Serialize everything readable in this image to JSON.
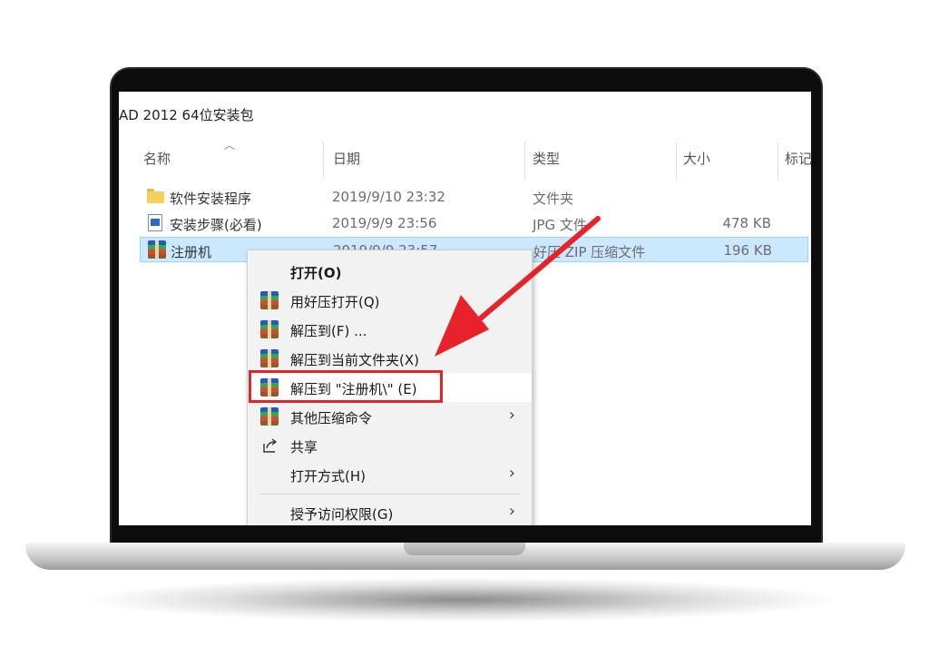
{
  "window": {
    "title": "AD 2012 64位安装包"
  },
  "columns": {
    "name": "名称",
    "date": "日期",
    "type": "类型",
    "size": "大小",
    "tags": "标记"
  },
  "files": [
    {
      "name": "软件安装程序",
      "date": "2019/9/10 23:32",
      "type": "文件夹",
      "size": "",
      "icon": "folder-icon"
    },
    {
      "name": "安装步骤(必看)",
      "date": "2019/9/9 23:56",
      "type": "JPG 文件",
      "size": "478 KB",
      "icon": "image-file-icon"
    },
    {
      "name": "注册机",
      "date": "2019/9/9 23:57",
      "type": "好压 ZIP 压缩文件",
      "size": "196 KB",
      "icon": "archive-icon",
      "selected": true
    }
  ],
  "context_menu": {
    "items": [
      {
        "label": "打开(O)",
        "icon": "",
        "bold": true,
        "submenu": false
      },
      {
        "label": "用好压打开(Q)",
        "icon": "archive-icon",
        "submenu": false
      },
      {
        "label": "解压到(F) ...",
        "icon": "archive-icon",
        "submenu": false
      },
      {
        "label": "解压到当前文件夹(X)",
        "icon": "archive-icon",
        "submenu": false
      },
      {
        "label": "解压到 \"注册机\\\" (E)",
        "icon": "archive-icon",
        "submenu": false,
        "highlighted": true
      },
      {
        "label": "其他压缩命令",
        "icon": "archive-icon",
        "submenu": true
      },
      {
        "label": "共享",
        "icon": "share-icon",
        "submenu": false
      },
      {
        "label": "打开方式(H)",
        "icon": "",
        "submenu": true
      },
      {
        "label": "授予访问权限(G)",
        "icon": "",
        "submenu": true
      }
    ],
    "chevron": "›"
  },
  "colors": {
    "selection": "#cce8ff",
    "highlight_box": "#e0262b",
    "arrow": "#e8222a"
  }
}
